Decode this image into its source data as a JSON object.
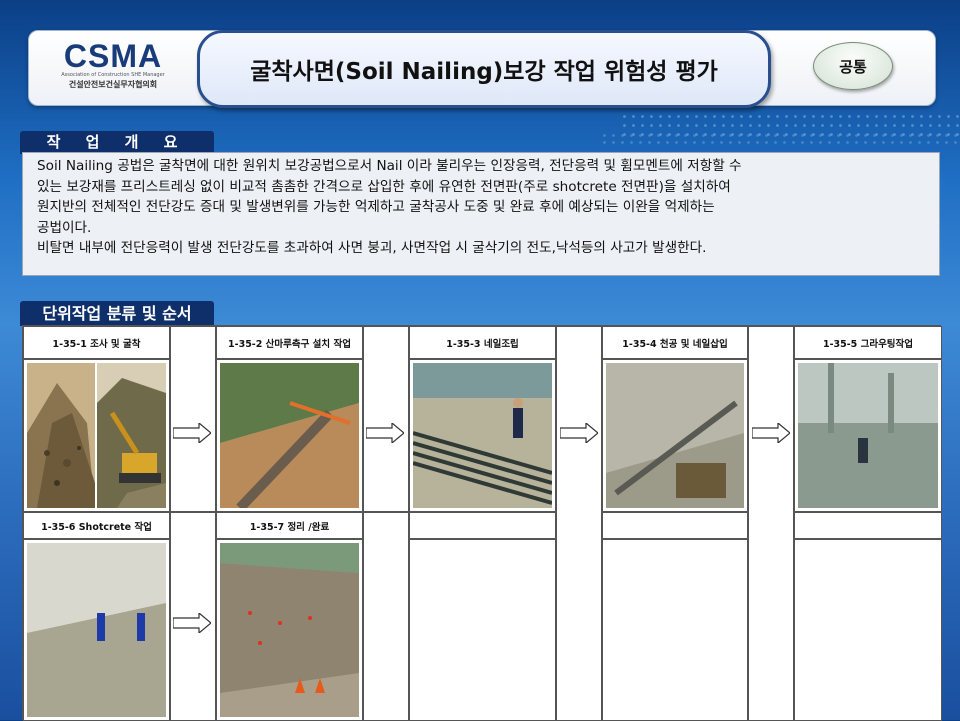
{
  "header": {
    "logo_text": "CSMA",
    "logo_subtext": "Association of Construction SHE Manager",
    "logo_korean": "건설안전보건실무자협의회",
    "title": "굴착사면(Soil Nailing)보강 작업 위험성 평가",
    "badge": "공통"
  },
  "overview": {
    "label": "작 업 개 요",
    "paragraph1_line1": "Soil Nailing 공법은 굴착면에 대한 원위치 보강공법으로서 Nail 이라 불리우는 인장응력, 전단응력 및 휨모멘트에 저항할 수",
    "paragraph1_line2": "있는 보강재를 프리스트레싱 없이 비교적 촘촘한 간격으로 삽입한 후에 유연한 전면판(주로 shotcrete 전면판)을 설치하여",
    "paragraph1_line3": "원지반의 전체적인 전단강도 증대 및 발생변위를 가능한 억제하고 굴착공사 도중 및 완료 후에 예상되는 이완을 억제하는",
    "paragraph1_line4": "공법이다.",
    "paragraph2": "비탈면 내부에 전단응력이 발생 전단강도를 초과하여 사면 붕괴, 사면작업 시 굴삭기의 전도,낙석등의 사고가 발생한다."
  },
  "steps": {
    "label": "단위작업 분류 및 순서",
    "items": [
      {
        "label": "1-35-1 조사 및 굴착"
      },
      {
        "label": "1-35-2 산마루측구 설치 작업"
      },
      {
        "label": "1-35-3 네일조립"
      },
      {
        "label": "1-35-4 천공 및 네일삽입"
      },
      {
        "label": "1-35-5 그라우팅작업"
      },
      {
        "label": "1-35-6 Shotcrete  작업"
      },
      {
        "label": "1-35-7 정리 /완료"
      }
    ]
  },
  "colors": {
    "label_bg": "#0f2f6a",
    "title_border": "#2a4f8f"
  }
}
